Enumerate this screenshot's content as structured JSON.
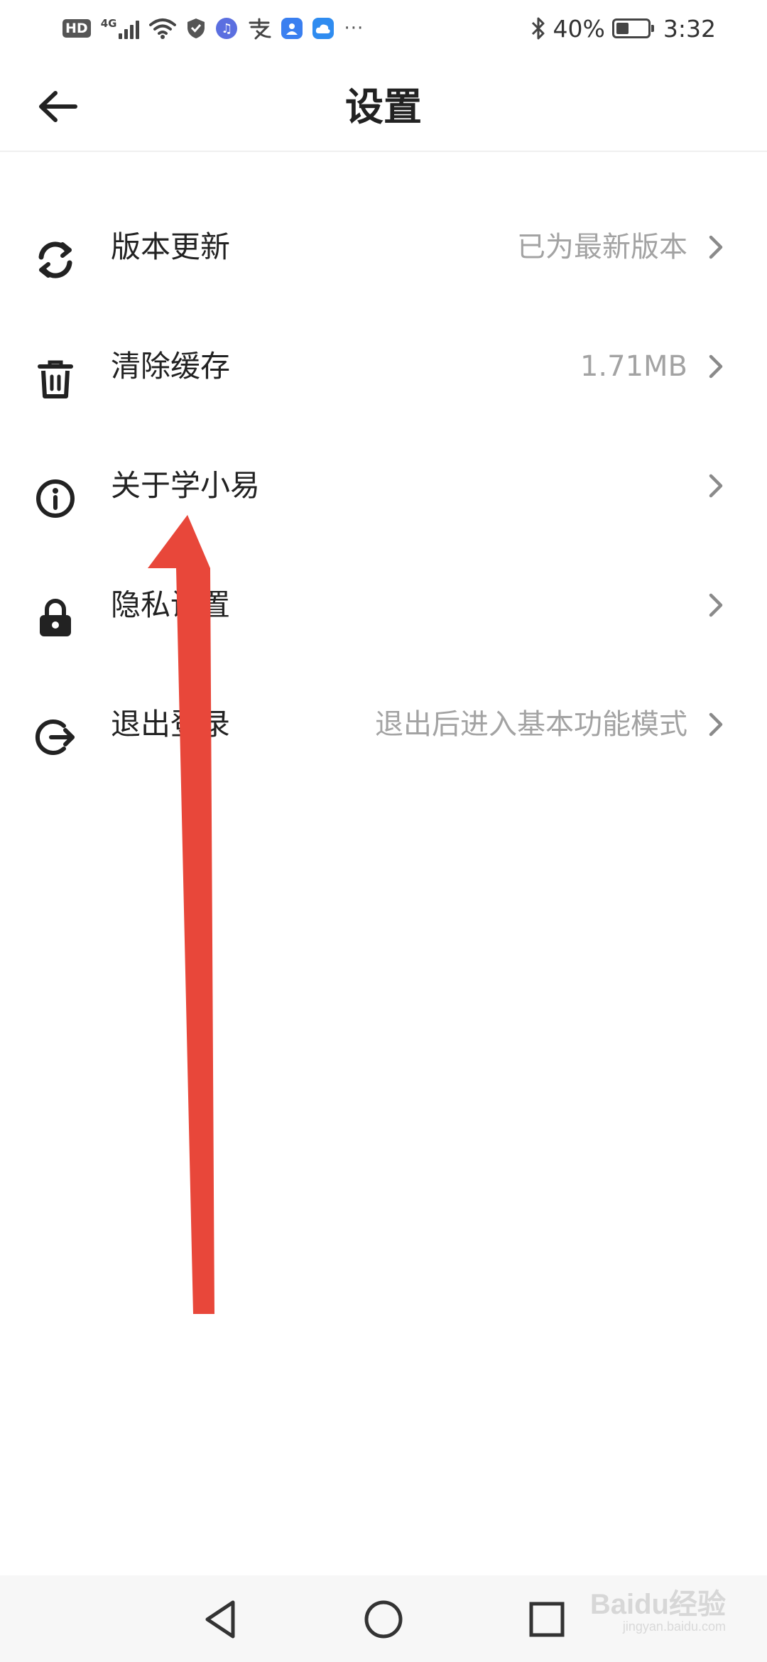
{
  "status_bar": {
    "hd_badge": "HD",
    "network": "4G",
    "bluetooth_icon": "bluetooth-icon",
    "battery_percent_text": "40%",
    "battery_level": 0.4,
    "time": "3:32",
    "more_dots": "···"
  },
  "header": {
    "back_icon": "back-arrow-icon",
    "title": "设置"
  },
  "settings": [
    {
      "icon": "refresh-icon",
      "label": "版本更新",
      "value": "已为最新版本"
    },
    {
      "icon": "trash-icon",
      "label": "清除缓存",
      "value": "1.71MB"
    },
    {
      "icon": "info-icon",
      "label": "关于学小易",
      "value": ""
    },
    {
      "icon": "lock-icon",
      "label": "隐私设置",
      "value": ""
    },
    {
      "icon": "logout-icon",
      "label": "退出登录",
      "value": "退出后进入基本功能模式"
    }
  ],
  "nav_bar": {
    "back_icon": "nav-back-icon",
    "home_icon": "nav-home-icon",
    "recents_icon": "nav-recents-icon"
  },
  "watermark": {
    "brand": "Baidu经验",
    "site": "jingyan.baidu.com"
  },
  "colors": {
    "accent_arrow": "#e8473a",
    "secondary_text": "#a3a3a3",
    "primary_text": "#222222"
  }
}
